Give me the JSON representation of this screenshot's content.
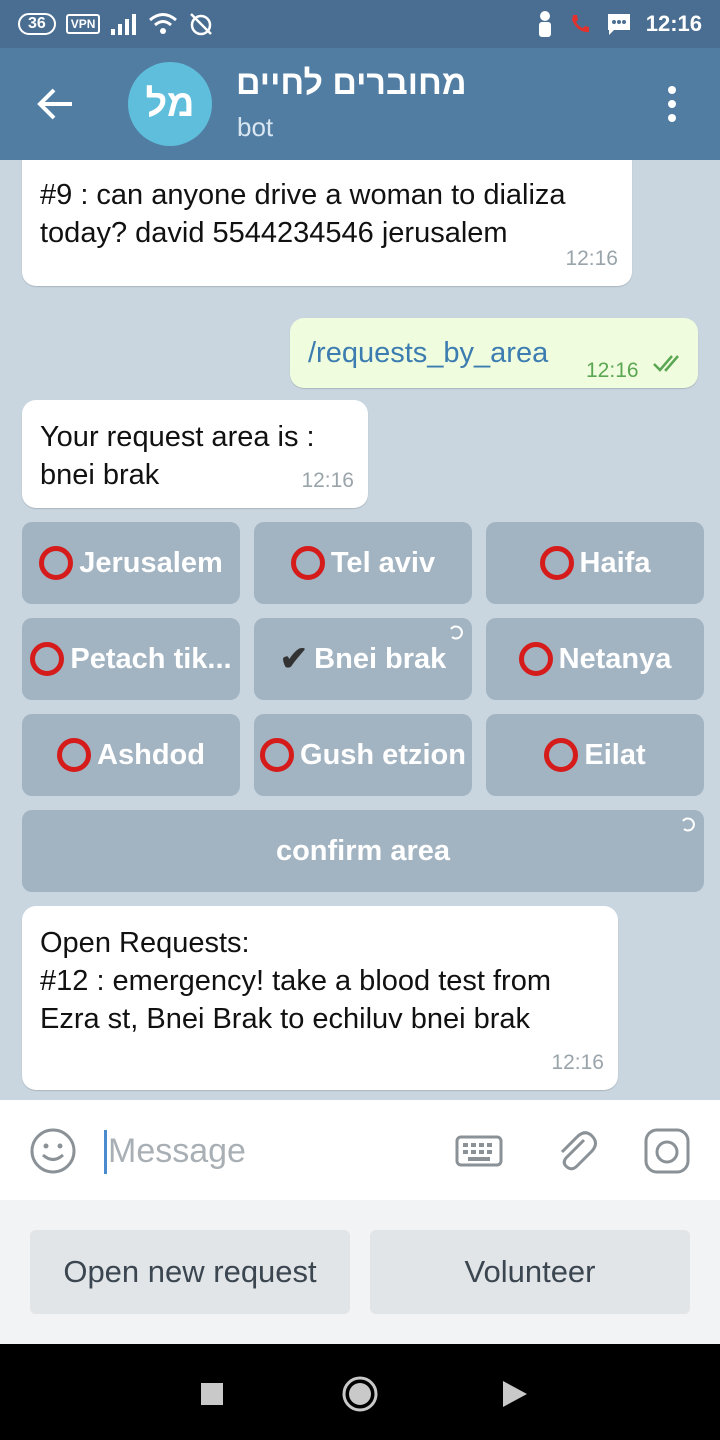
{
  "status_bar": {
    "network_badge": "36",
    "vpn_badge": "VPN",
    "time": "12:16"
  },
  "header": {
    "avatar_initials": "מל",
    "title": "מחוברים לחיים",
    "subtitle": "bot"
  },
  "messages": [
    {
      "text": "#9 : can anyone drive a woman to dializa today? david 5544234546 jerusalem",
      "time": "12:16"
    },
    {
      "text": "/requests_by_area",
      "time": "12:16"
    },
    {
      "text": "Your request area is :\nbnei brak",
      "time": "12:16"
    },
    {
      "text": "Open Requests:\n#12 :  emergency! take a blood test from Ezra st, Bnei Brak to echiluv   bnei brak",
      "time": "12:16"
    }
  ],
  "inline_keyboard": {
    "buttons": [
      {
        "label": "Jerusalem",
        "state": "unselected"
      },
      {
        "label": "Tel aviv",
        "state": "unselected"
      },
      {
        "label": "Haifa",
        "state": "unselected"
      },
      {
        "label": "Petach tik...",
        "state": "unselected"
      },
      {
        "label": "Bnei brak",
        "state": "selected"
      },
      {
        "label": "Netanya",
        "state": "unselected"
      },
      {
        "label": "Ashdod",
        "state": "unselected"
      },
      {
        "label": "Gush etzion",
        "state": "unselected"
      },
      {
        "label": "Eilat",
        "state": "unselected"
      }
    ],
    "confirm_label": "confirm area"
  },
  "composer": {
    "placeholder": "Message"
  },
  "reply_keyboard": {
    "buttons": [
      "Open new request",
      "Volunteer"
    ]
  },
  "colors": {
    "header": "#527da3",
    "status_bar": "#4a6e92",
    "unselected_ring": "#d61b1b",
    "outgoing_bubble": "#effdde"
  }
}
